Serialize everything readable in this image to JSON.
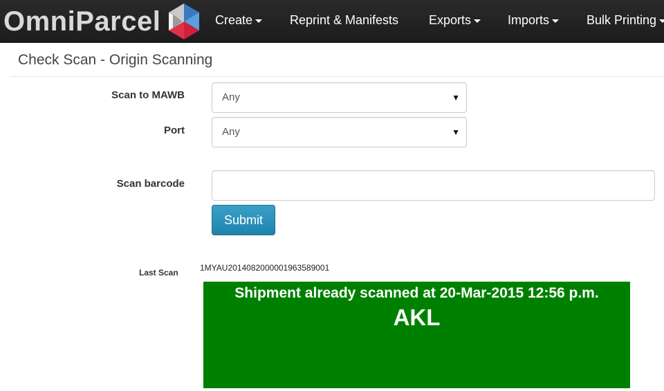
{
  "brand": {
    "name": "OmniParcel"
  },
  "nav": {
    "items": [
      {
        "label": "Create",
        "dropdown": true
      },
      {
        "label": "Reprint & Manifests",
        "dropdown": false
      },
      {
        "label": "Exports",
        "dropdown": true
      },
      {
        "label": "Imports",
        "dropdown": true
      },
      {
        "label": "Bulk Printing",
        "dropdown": true
      }
    ]
  },
  "page": {
    "title": "Check Scan - Origin Scanning"
  },
  "form": {
    "mawb": {
      "label": "Scan to MAWB",
      "value": "Any"
    },
    "port": {
      "label": "Port",
      "value": "Any"
    },
    "barcode": {
      "label": "Scan barcode",
      "value": "",
      "placeholder": ""
    },
    "submit_label": "Submit"
  },
  "last_scan": {
    "label": "Last Scan",
    "value": "1MYAU2014082000001963589001",
    "message": "Shipment already scanned at 20-Mar-2015 12:56 p.m.",
    "code": "AKL"
  },
  "colors": {
    "navbar": "#222222",
    "primary_button": "#2a8fb8",
    "result_background": "#008000"
  }
}
